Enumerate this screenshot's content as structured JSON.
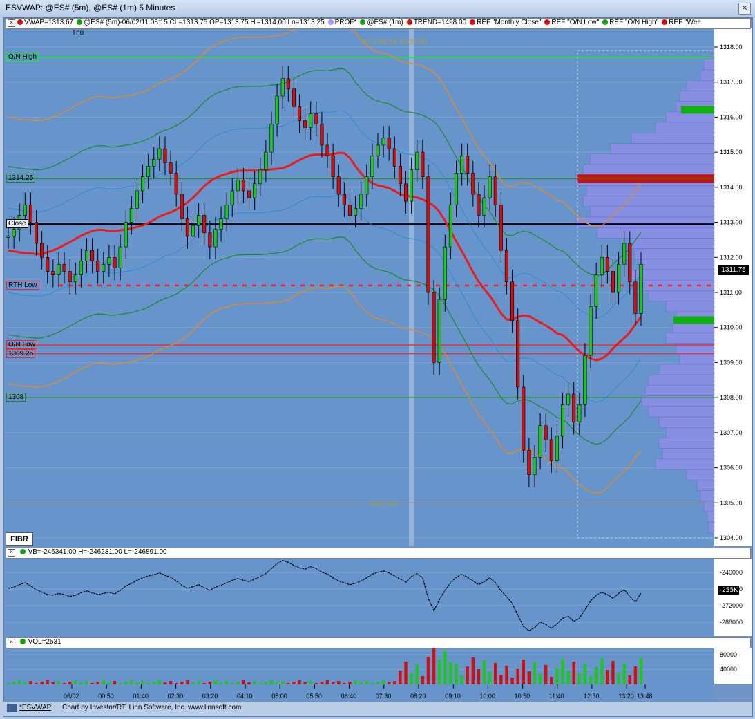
{
  "window": {
    "title": "ESVWAP: @ES# (5m), @ES# (1m) 5 Minutes",
    "close_glyph": "✕"
  },
  "legend": [
    {
      "text": "VWAP=1313.67",
      "color": "#d01010"
    },
    {
      "text": "@ES# (5m)-06/02/11 08:15 CL=1313.75 OP=1313.75 Hi=1314.00 Lo=1313.25",
      "color": "#10a010"
    },
    {
      "text": "PROF*",
      "color": "#a0a0ff"
    },
    {
      "text": "@ES# (1m)",
      "color": "#10a010"
    },
    {
      "text": "TREND=1498.00",
      "color": "#d01010"
    },
    {
      "text": "REF \"Monthly Close\"",
      "color": "#d01010"
    },
    {
      "text": "REF \"O/N Low\"",
      "color": "#d01010"
    },
    {
      "text": "REF \"O/N High\"",
      "color": "#10a010"
    },
    {
      "text": "REF \"Wee",
      "color": "#d01010"
    }
  ],
  "day_label": "Thu",
  "annotations": {
    "top": "6/ 2 08:15  1305.00",
    "bottom": "1305.00"
  },
  "ref_lines": [
    {
      "label": "O/N High",
      "price": 1317.7,
      "color": "#00ff00"
    },
    {
      "label": "1314.25",
      "price": 1314.25,
      "color": "#208020"
    },
    {
      "label": "Close",
      "price": 1312.95,
      "color": "#000000"
    },
    {
      "label": "RTH Low",
      "price": 1311.2,
      "color": "#ff2020"
    },
    {
      "label": "O/N Low",
      "price": 1309.5,
      "color": "#ff2020"
    },
    {
      "label": "1309.25",
      "price": 1309.25,
      "color": "#ff2020"
    },
    {
      "label": "1308",
      "price": 1308,
      "color": "#208020"
    }
  ],
  "last_price": "1311.75",
  "fibr_label": "FIBR",
  "vb_legend": "VB=-246341.00 H=-246231.00 L=-246891.00",
  "vb_last": "-255K",
  "vol_legend": "VOL=2531",
  "status": {
    "name": "*ESVWAP",
    "credit": "Chart by Investor/RT, Linn Software, Inc. www.linnsoft.com"
  },
  "chart_data": {
    "type": "line",
    "title": "ESVWAP: @ES# (5m), @ES# (1m) 5 Minutes",
    "x_ticks": [
      "06/02",
      "00:50",
      "01:40",
      "02:30",
      "03:20",
      "04:10",
      "05:00",
      "05:50",
      "06:40",
      "07:30",
      "08:20",
      "09:10",
      "10:00",
      "10:50",
      "11:40",
      "12:30",
      "13:20",
      "13:48"
    ],
    "y_ticks": [
      "1304.00",
      "1305.00",
      "1306.00",
      "1307.00",
      "1308.00",
      "1309.00",
      "1310.00",
      "1311.00",
      "1312.00",
      "1313.00",
      "1314.00",
      "1315.00",
      "1316.00",
      "1317.00",
      "1318.00"
    ],
    "ylim": [
      1304,
      1318
    ],
    "closes": [
      1312.6,
      1312.8,
      1313.2,
      1313.5,
      1313.0,
      1312.4,
      1312.0,
      1311.6,
      1311.5,
      1311.8,
      1311.6,
      1311.3,
      1311.5,
      1311.9,
      1312.2,
      1311.9,
      1311.6,
      1311.8,
      1312.0,
      1311.7,
      1312.3,
      1313.0,
      1313.4,
      1313.9,
      1314.3,
      1314.6,
      1314.8,
      1315.1,
      1314.7,
      1314.4,
      1313.8,
      1313.1,
      1312.6,
      1312.9,
      1313.2,
      1312.7,
      1312.3,
      1312.8,
      1313.1,
      1313.5,
      1313.9,
      1314.2,
      1313.9,
      1313.7,
      1314.1,
      1314.5,
      1315.0,
      1315.8,
      1316.6,
      1317.1,
      1316.8,
      1316.3,
      1315.9,
      1315.7,
      1316.1,
      1315.8,
      1315.2,
      1314.9,
      1314.3,
      1313.8,
      1313.5,
      1313.2,
      1313.4,
      1313.8,
      1314.3,
      1314.9,
      1315.2,
      1315.4,
      1315.1,
      1314.6,
      1314.1,
      1313.6,
      1314.5,
      1315.0,
      1314.3,
      1311.0,
      1309.0,
      1310.8,
      1312.3,
      1313.5,
      1314.4,
      1314.9,
      1314.4,
      1313.8,
      1313.2,
      1313.7,
      1314.3,
      1313.5,
      1312.2,
      1311.3,
      1310.2,
      1308.3,
      1306.5,
      1305.8,
      1306.3,
      1307.2,
      1306.8,
      1306.2,
      1306.9,
      1307.8,
      1308.1,
      1307.3,
      1307.8,
      1309.2,
      1310.6,
      1311.5,
      1312.0,
      1311.6,
      1311.0,
      1311.8,
      1312.4,
      1311.3,
      1310.4,
      1311.8
    ]
  }
}
